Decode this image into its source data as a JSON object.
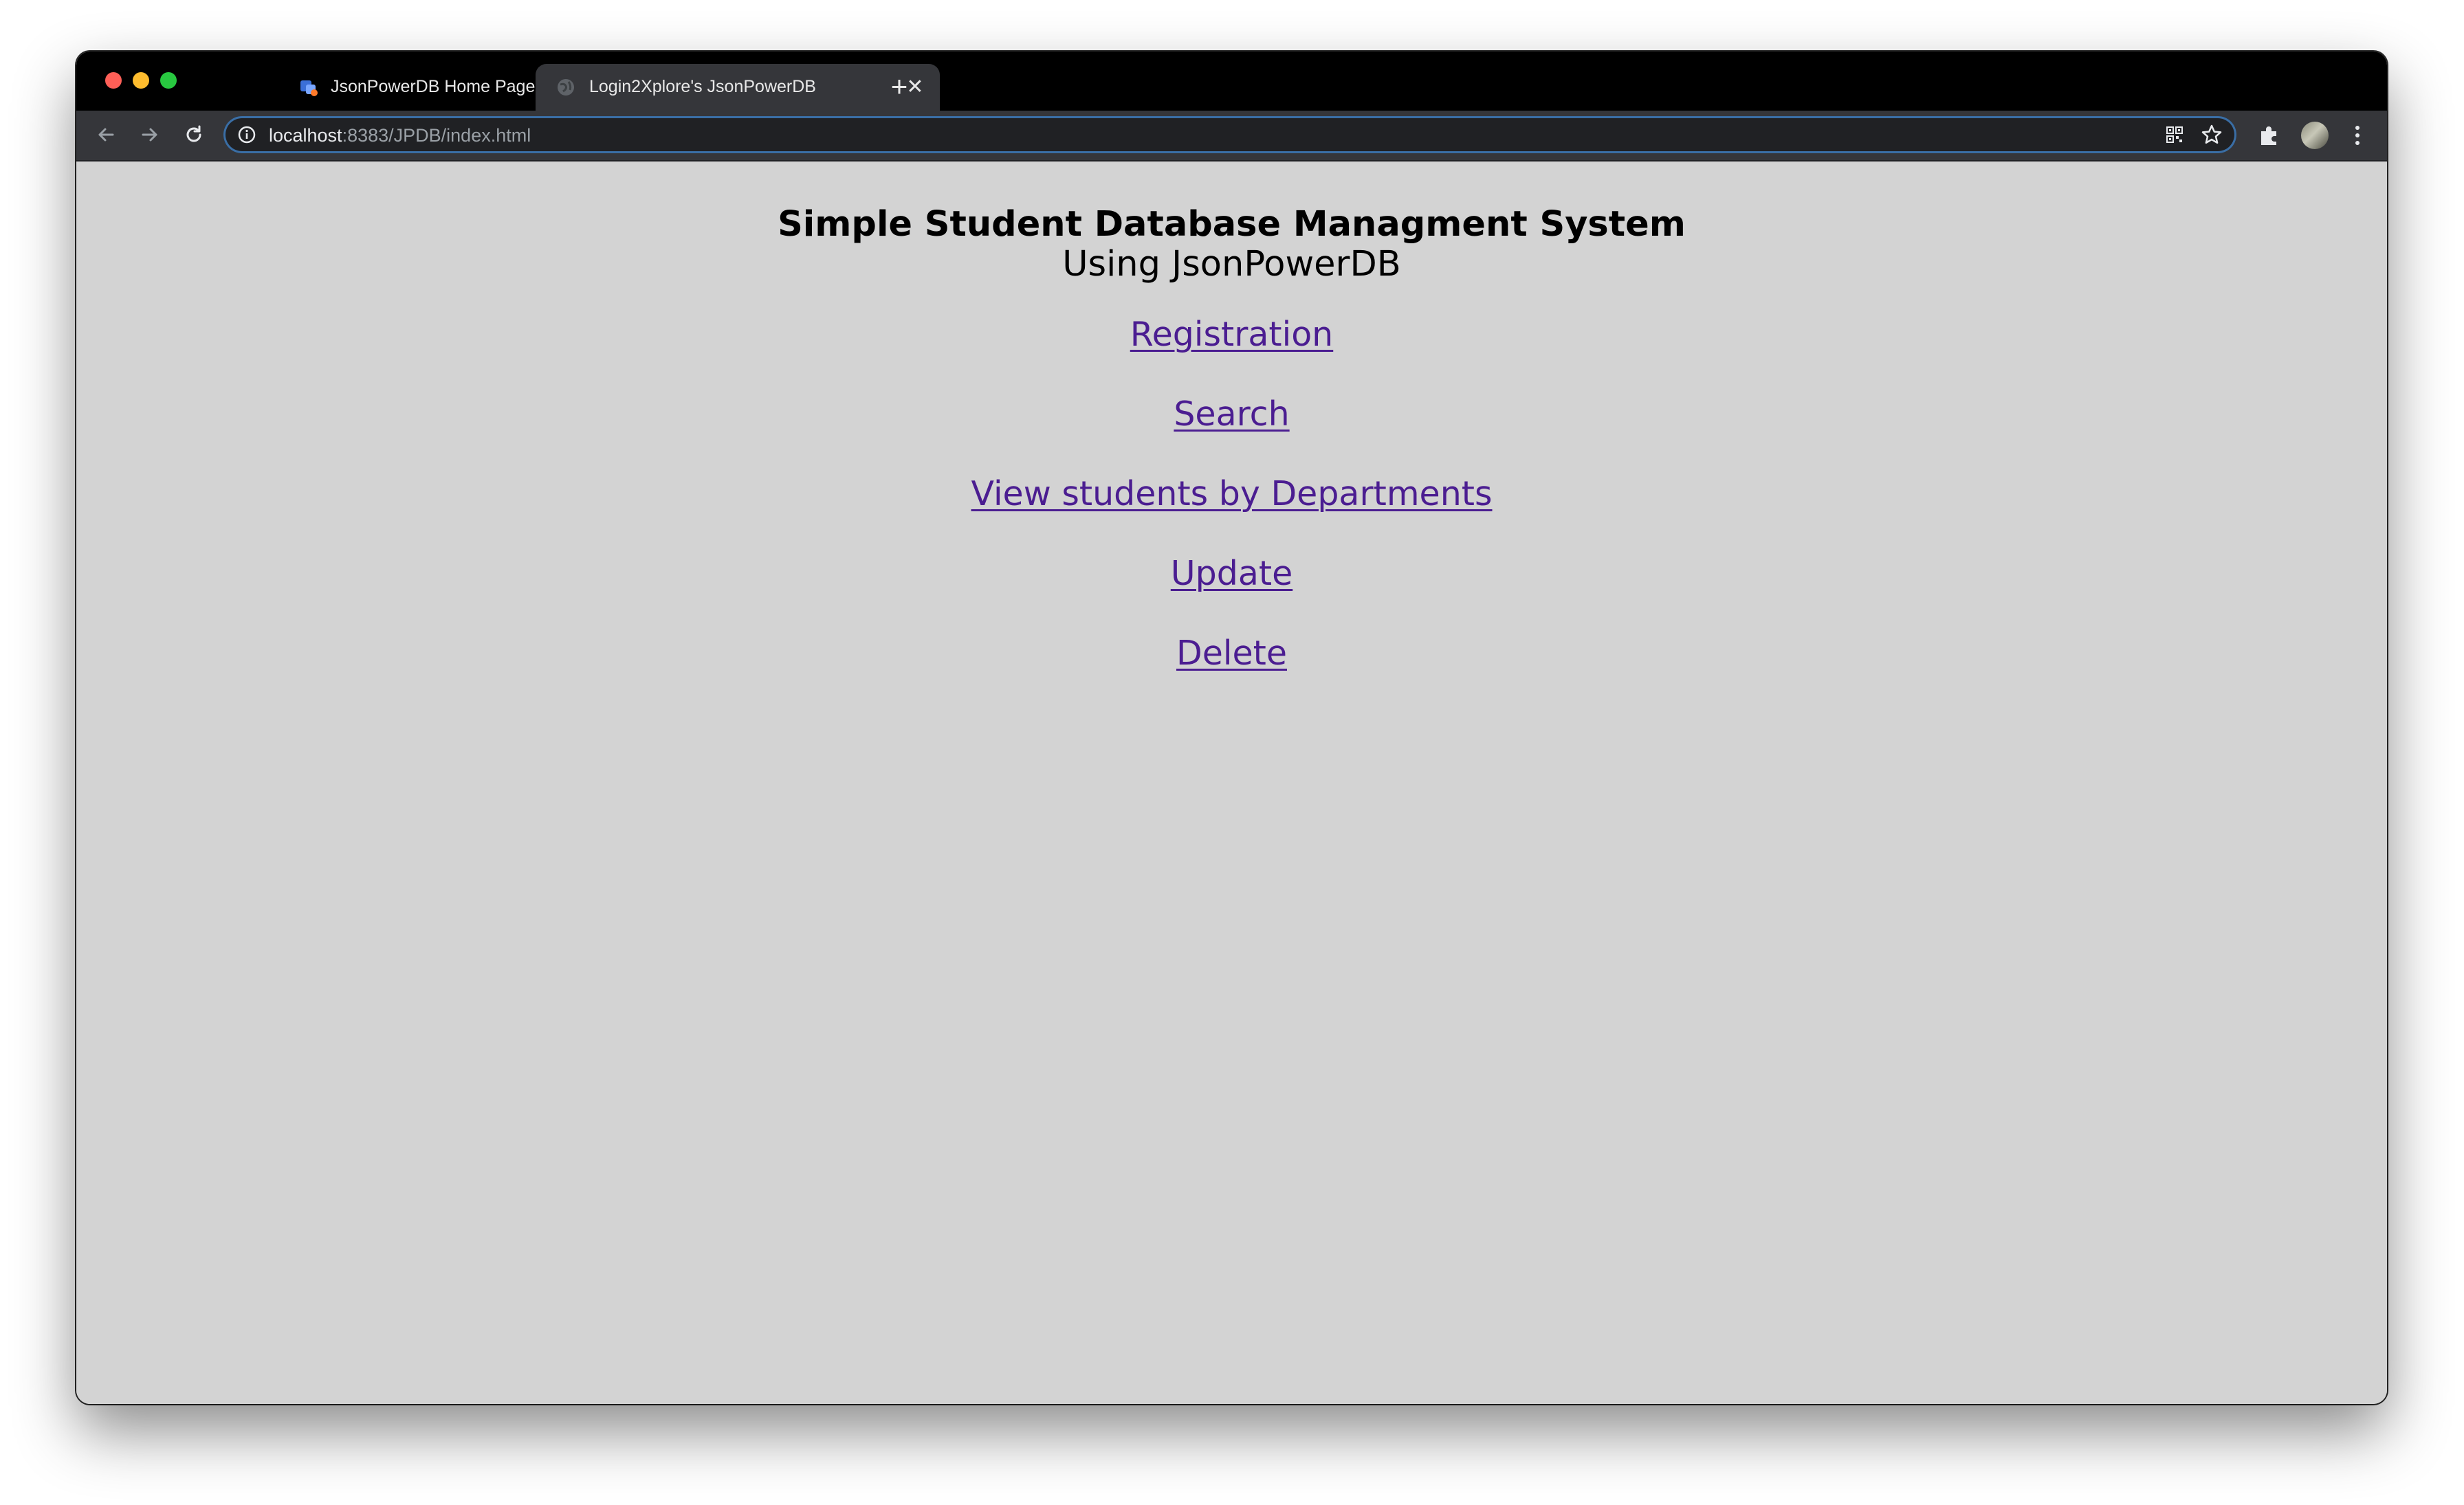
{
  "browser": {
    "tabs": [
      {
        "label": "JsonPowerDB Home Page",
        "active": false,
        "icon": "jpdb-favicon"
      },
      {
        "label": "Login2Xplore's JsonPowerDB",
        "active": true,
        "icon": "globe-favicon"
      }
    ],
    "new_tab_label": "+",
    "close_label": "✕",
    "url_host": "localhost",
    "url_path": ":8383/JPDB/index.html"
  },
  "page": {
    "title": "Simple Student Database Managment System",
    "subtitle": "Using JsonPowerDB",
    "links": [
      {
        "label": "Registration"
      },
      {
        "label": "Search"
      },
      {
        "label": "View students by Departments"
      },
      {
        "label": "Update"
      },
      {
        "label": "Delete"
      }
    ]
  },
  "colors": {
    "page_background": "#d3d3d3",
    "link": "#4b1d91",
    "chrome_dark": "#35363a"
  }
}
